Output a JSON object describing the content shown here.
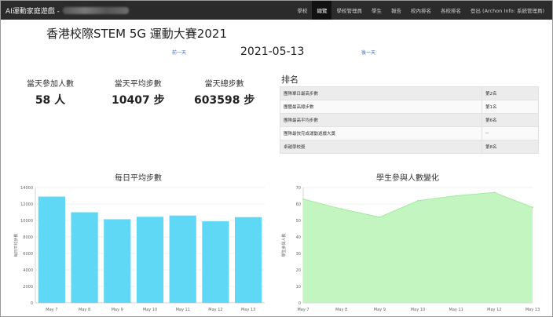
{
  "navbar": {
    "brand": "AI運動家庭遊戲 -",
    "items": [
      {
        "label": "學校",
        "active": false
      },
      {
        "label": "總覽",
        "active": true
      },
      {
        "label": "學校管理員",
        "active": false
      },
      {
        "label": "學生",
        "active": false
      },
      {
        "label": "報告",
        "active": false
      },
      {
        "label": "校內排名",
        "active": false
      },
      {
        "label": "各校排名",
        "active": false
      },
      {
        "label": "登出 (Archon Info: 系統管理員)",
        "active": false
      }
    ]
  },
  "header": {
    "title": "香港校際STEM 5G 運動大賽2021",
    "prev_label": "前一天",
    "date": "2021-05-13",
    "next_label": "後一天"
  },
  "stats": [
    {
      "label": "當天參加人數",
      "value": "58 人"
    },
    {
      "label": "當天平均步數",
      "value": "10407 步"
    },
    {
      "label": "當天總步數",
      "value": "603598 步"
    }
  ],
  "ranking": {
    "title": "排名",
    "rows": [
      {
        "name": "團隊單日最高步數",
        "rank": "第2名"
      },
      {
        "name": "團體最高總步數",
        "rank": "第1名"
      },
      {
        "name": "團隊最高平均步數",
        "rank": "第6名"
      },
      {
        "name": "團隊最快完成運動遊戲大獎",
        "rank": "--"
      },
      {
        "name": "卓越學校獎",
        "rank": "第8名"
      }
    ]
  },
  "colors": {
    "navbar_bg": "#2b2b2b",
    "bar_fill": "#5fd8f5",
    "area_fill": "#c3f5c0",
    "area_stroke": "#a6e8a2"
  },
  "chart_data": [
    {
      "type": "bar",
      "title": "每日平均步數",
      "ylabel": "每日平均步數",
      "categories": [
        "May 7",
        "May 8",
        "May 9",
        "May 10",
        "May 11",
        "May 12",
        "May 13"
      ],
      "values": [
        12900,
        11000,
        10150,
        10450,
        10600,
        9900,
        10407
      ],
      "ylim": [
        0,
        14000
      ],
      "yticks": [
        0,
        2000,
        4000,
        6000,
        8000,
        10000,
        12000,
        14000
      ],
      "grid": true
    },
    {
      "type": "area",
      "title": "學生參與人數變化",
      "ylabel": "學生參與人數",
      "categories": [
        "May 7",
        "May 8",
        "May 9",
        "May 10",
        "May 11",
        "May 12",
        "May 13"
      ],
      "values": [
        63,
        57,
        52,
        62,
        65,
        67,
        58
      ],
      "ylim": [
        0,
        70
      ],
      "yticks": [
        0,
        10,
        20,
        30,
        40,
        50,
        60,
        70
      ],
      "grid": true
    }
  ]
}
